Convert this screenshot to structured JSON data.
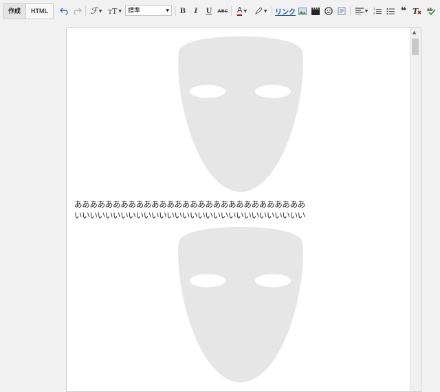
{
  "toolbar": {
    "compose_tab": "作成",
    "html_tab": "HTML",
    "font_family_value": "標準",
    "link_label": "リンク",
    "bold_label": "B",
    "italic_label": "I",
    "underline_label": "U",
    "strike_label": "ABC",
    "text_color_label": "A"
  },
  "editor": {
    "line1": "ああああああああああああああああああああああああああああああ",
    "line2": "いいいいいいいいいいいいいいいいいいいいいいいいいいいいいい"
  },
  "colors": {
    "mask_fill": "#e6e6e6",
    "link_color": "#1a55b3",
    "text_color_underline": "#c00000"
  }
}
